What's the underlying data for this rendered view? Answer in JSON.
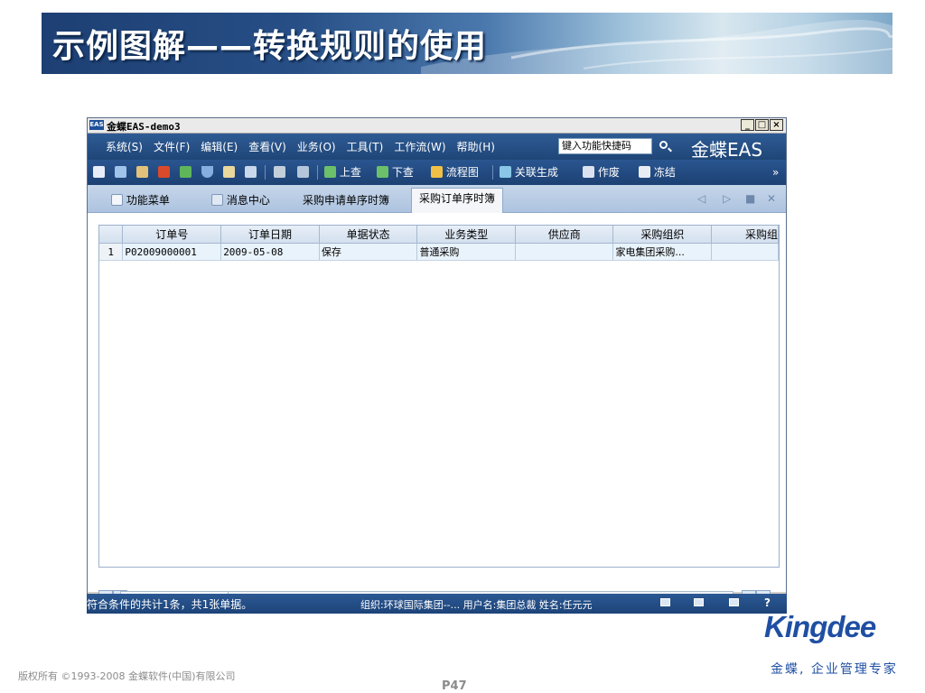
{
  "slide": {
    "title": "示例图解——转换规则的使用",
    "page_number": "P47",
    "copyright": "版权所有 ©1993-2008 金蝶软件(中国)有限公司",
    "logo_text": "Kingdee",
    "slogan": "金蝶, 企业管理专家"
  },
  "window": {
    "title": "金蝶EAS-demo3",
    "icon_text": "EAS",
    "controls": [
      "_",
      "□",
      "×"
    ]
  },
  "menu": {
    "items": [
      "系统(S)",
      "文件(F)",
      "编辑(E)",
      "查看(V)",
      "业务(O)",
      "工具(T)",
      "工作流(W)",
      "帮助(H)"
    ],
    "search_placeholder": "键入功能快捷码",
    "brand": "金蝶EAS"
  },
  "toolbar": {
    "up_query": "上查",
    "down_query": "下查",
    "flowchart": "流程图",
    "linked_generate": "关联生成",
    "void": "作废",
    "freeze": "冻结",
    "more": "»"
  },
  "tabs": {
    "function_menu": "功能菜单",
    "message_center": "消息中心",
    "purchase_request": "采购申请单序时簿",
    "purchase_order": "采购订单序时簿"
  },
  "grid": {
    "columns": [
      "订单号",
      "订单日期",
      "单据状态",
      "业务类型",
      "供应商",
      "采购组织",
      "采购组"
    ],
    "rows": [
      {
        "row_num": "1",
        "cells": [
          "P02009000001",
          "2009-05-08",
          "保存",
          "普通采购",
          "",
          "家电集团采购...",
          ""
        ]
      }
    ]
  },
  "status": {
    "summary": "符合条件的共计1条，共1张单据。",
    "org_user": "组织:环球国际集团--...  用户名:集团总裁  姓名:任元元",
    "help": "?"
  },
  "colors": {
    "window_blue": "#1f4677",
    "grid_row": "#e9f3fb",
    "brand_blue": "#1f4fa3"
  }
}
